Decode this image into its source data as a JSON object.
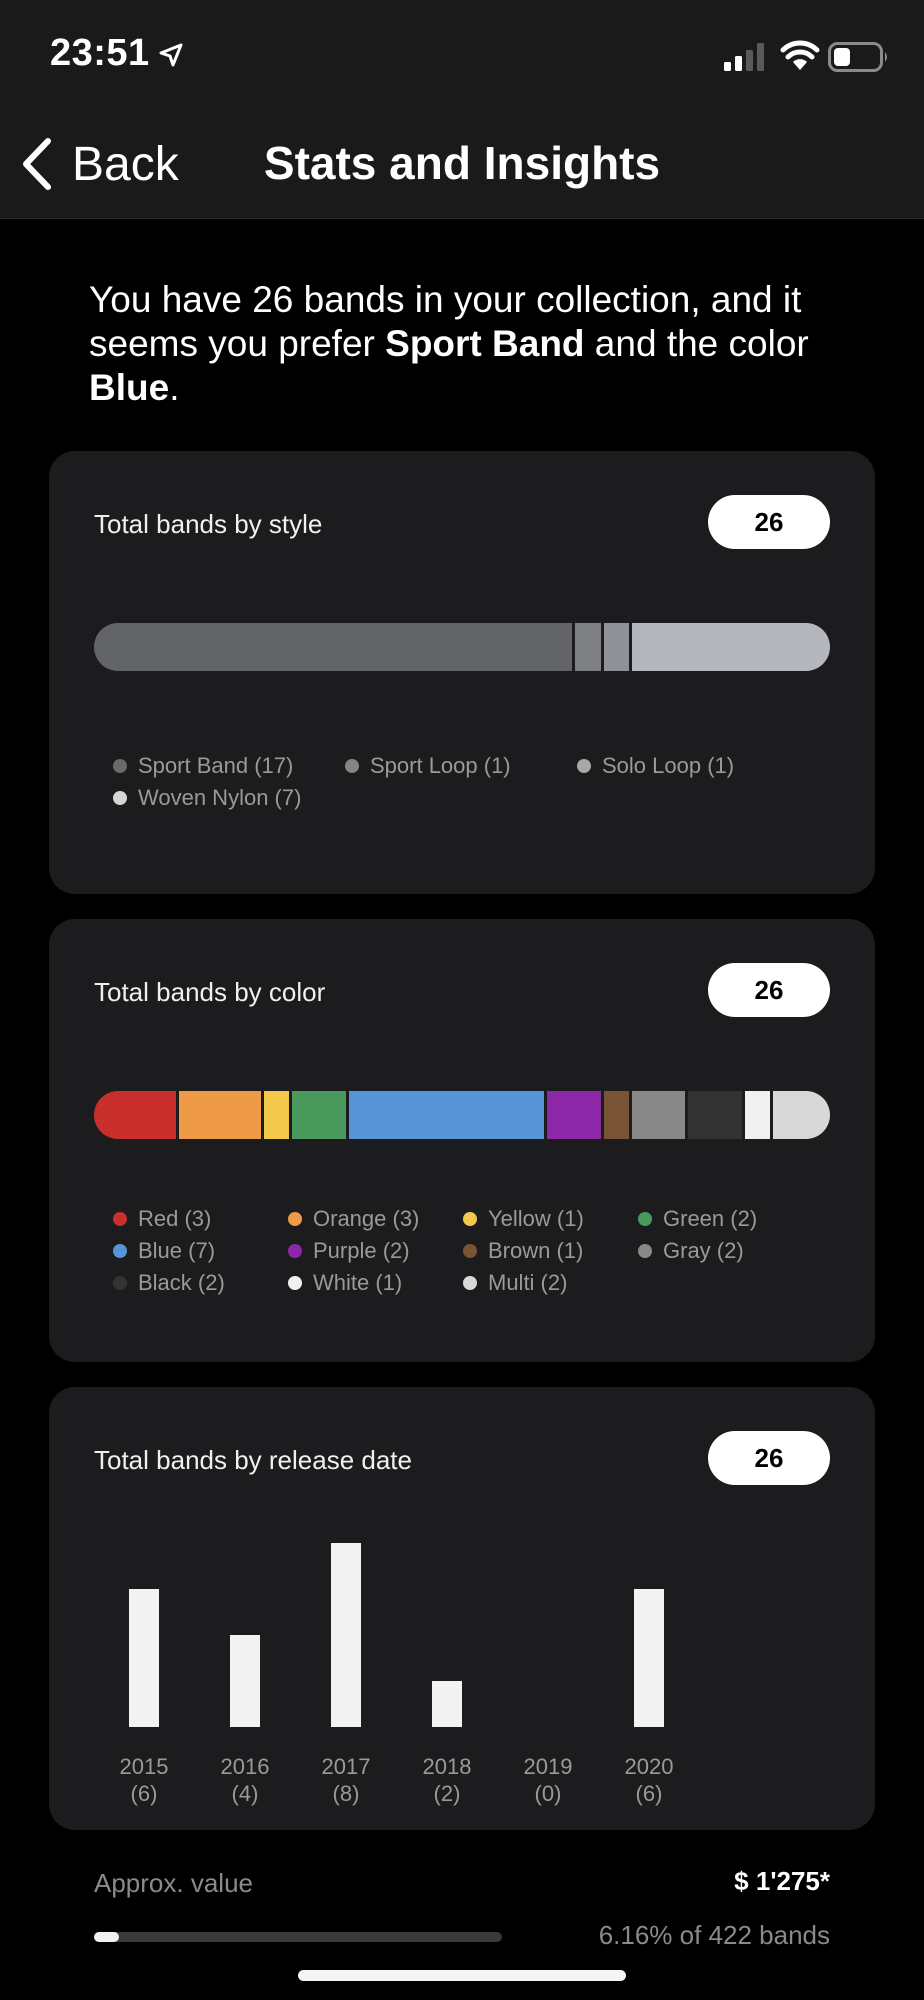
{
  "status_bar": {
    "time": "23:51"
  },
  "nav": {
    "back_label": "Back",
    "title": "Stats and Insights"
  },
  "intro": {
    "prefix": "You have 26 bands in your collection, and it seems you prefer ",
    "style": "Sport Band",
    "middle": " and the color ",
    "color": "Blue",
    "suffix": "."
  },
  "style_card": {
    "title": "Total bands by style",
    "total": "26",
    "segments": [
      {
        "label": "Sport Band (17)",
        "count": 17,
        "color": "#626466"
      },
      {
        "label": "Sport Loop (1)",
        "count": 1,
        "color": "#7e8084"
      },
      {
        "label": "Solo Loop (1)",
        "count": 1,
        "color": "#8f9196"
      },
      {
        "label": "Woven Nylon (7)",
        "count": 7,
        "color": "#b4b7bd"
      }
    ],
    "legend_dot_colors": [
      "#6b6b6b",
      "#858585",
      "#a8a8a8",
      "#d6d6d6"
    ]
  },
  "color_card": {
    "title": "Total bands by color",
    "total": "26",
    "segments": [
      {
        "label": "Red (3)",
        "count": 3,
        "color": "#c9302c"
      },
      {
        "label": "Orange (3)",
        "count": 3,
        "color": "#ee9a46"
      },
      {
        "label": "Yellow (1)",
        "count": 1,
        "color": "#f4c84c"
      },
      {
        "label": "Green (2)",
        "count": 2,
        "color": "#4b9a5d"
      },
      {
        "label": "Blue (7)",
        "count": 7,
        "color": "#5895d8"
      },
      {
        "label": "Purple (2)",
        "count": 2,
        "color": "#8c27a8"
      },
      {
        "label": "Brown (1)",
        "count": 1,
        "color": "#7a5535"
      },
      {
        "label": "Gray (2)",
        "count": 2,
        "color": "#888888"
      },
      {
        "label": "Black (2)",
        "count": 2,
        "color": "#333333"
      },
      {
        "label": "White (1)",
        "count": 1,
        "color": "#f0f0f0"
      },
      {
        "label": "Multi (2)",
        "count": 2,
        "color": "#d8d8d8"
      }
    ]
  },
  "release_card": {
    "title": "Total bands by release date",
    "total": "26"
  },
  "chart_data": {
    "type": "bar",
    "categories": [
      "2015",
      "2016",
      "2017",
      "2018",
      "2019",
      "2020"
    ],
    "values": [
      6,
      4,
      8,
      2,
      0,
      6
    ],
    "value_labels": [
      "(6)",
      "(4)",
      "(8)",
      "(2)",
      "(0)",
      "(6)"
    ],
    "ylim": [
      0,
      8
    ],
    "grid": false,
    "bar_color": "#f2f2f2"
  },
  "approx": {
    "label": "Approx. value",
    "value": "$ 1'275*",
    "progress_fraction": 0.0616,
    "progress_text": "6.16% of 422 bands"
  }
}
